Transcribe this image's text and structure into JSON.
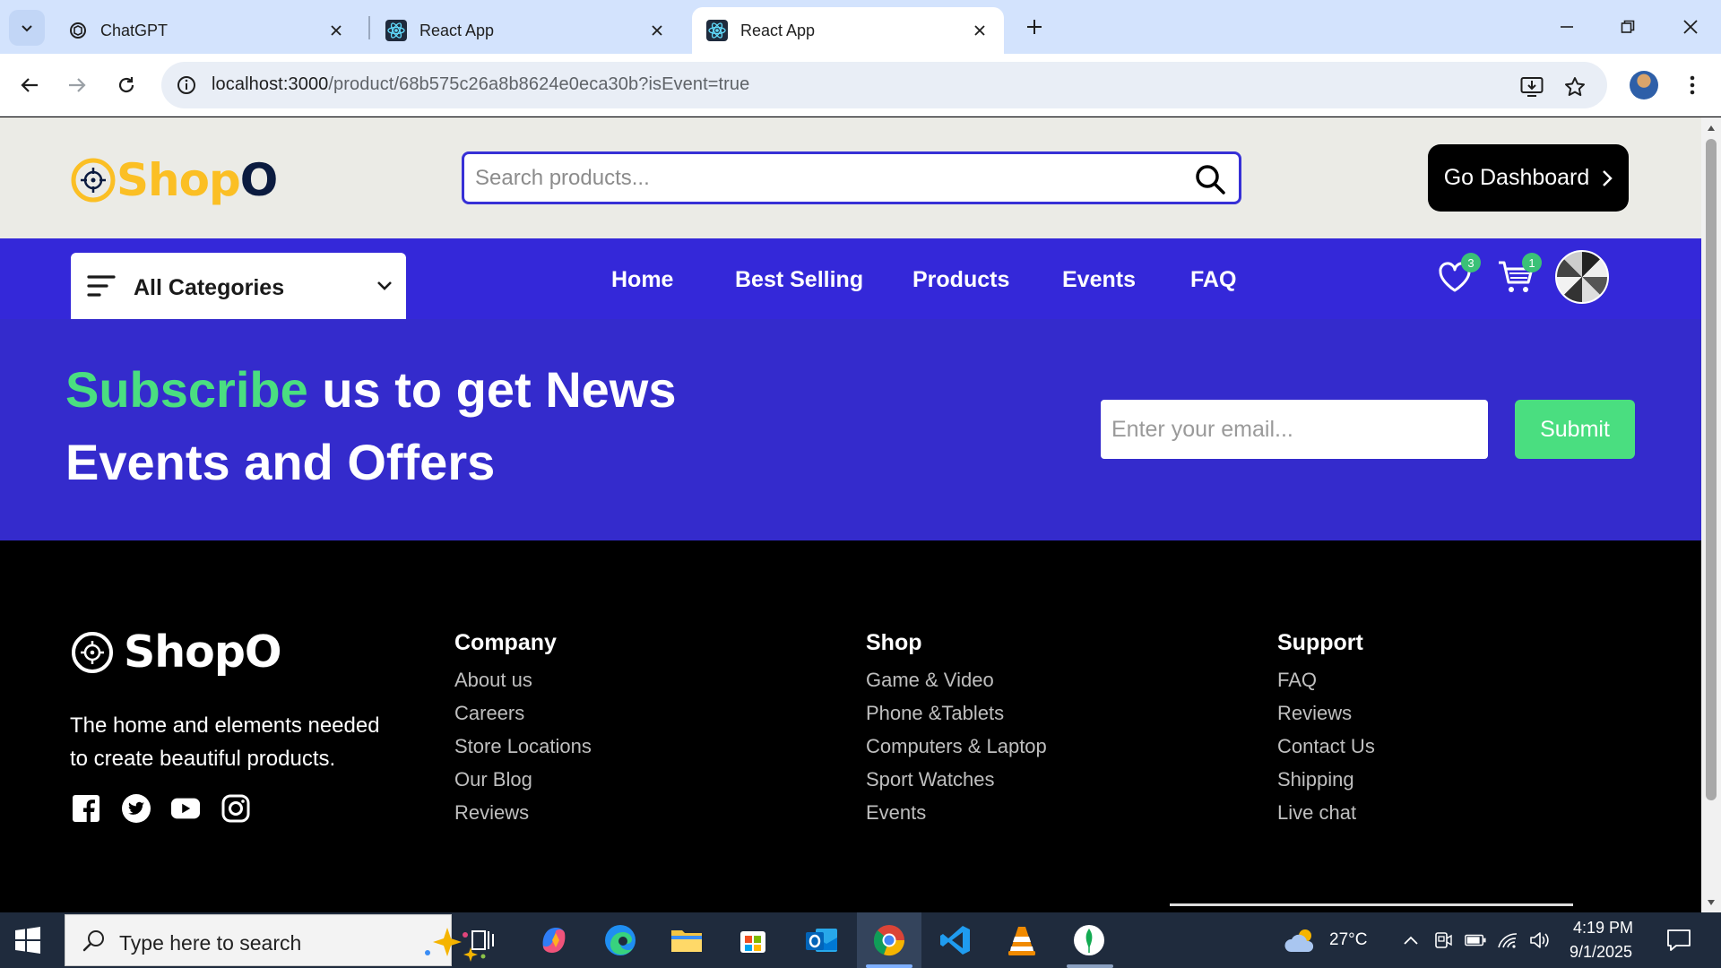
{
  "browser": {
    "tabs": [
      {
        "title": "ChatGPT",
        "icon": "chatgpt-icon",
        "active": false
      },
      {
        "title": "React App",
        "icon": "react-icon",
        "active": false
      },
      {
        "title": "React App",
        "icon": "react-icon",
        "active": true
      }
    ],
    "url_host": "localhost:3000",
    "url_path": "/product/68b575c26a8b8624e0eca30b?isEvent=true"
  },
  "header": {
    "logo_primary": "Shop",
    "logo_secondary": "O",
    "search_placeholder": "Search products...",
    "dashboard_label": "Go Dashboard"
  },
  "navbar": {
    "categories_label": "All Categories",
    "links": [
      "Home",
      "Best Selling",
      "Products",
      "Events",
      "FAQ"
    ],
    "wishlist_count": "3",
    "cart_count": "1"
  },
  "subscribe": {
    "highlight": "Subscribe",
    "heading_rest": " us to get News Events and Offers",
    "email_placeholder": "Enter your email...",
    "submit_label": "Submit"
  },
  "footer": {
    "logo_text": "ShopO",
    "tagline": "The home and elements needed to create beautiful products.",
    "columns": [
      {
        "title": "Company",
        "links": [
          "About us",
          "Careers",
          "Store Locations",
          "Our Blog",
          "Reviews"
        ]
      },
      {
        "title": "Shop",
        "links": [
          "Game & Video",
          "Phone &Tablets",
          "Computers & Laptop",
          "Sport Watches",
          "Events"
        ]
      },
      {
        "title": "Support",
        "links": [
          "FAQ",
          "Reviews",
          "Contact Us",
          "Shipping",
          "Live chat"
        ]
      }
    ],
    "social_icons": [
      "facebook-icon",
      "twitter-icon",
      "youtube-icon",
      "instagram-icon"
    ]
  },
  "taskbar": {
    "search_placeholder": "Type here to search",
    "weather": "27°C",
    "time": "4:19 PM",
    "date": "9/1/2025"
  },
  "colors": {
    "brand_blue": "#3428d9",
    "subscribe_bg": "#342bcc",
    "accent_green": "#4ade80",
    "logo_yellow": "#fbbf24"
  }
}
